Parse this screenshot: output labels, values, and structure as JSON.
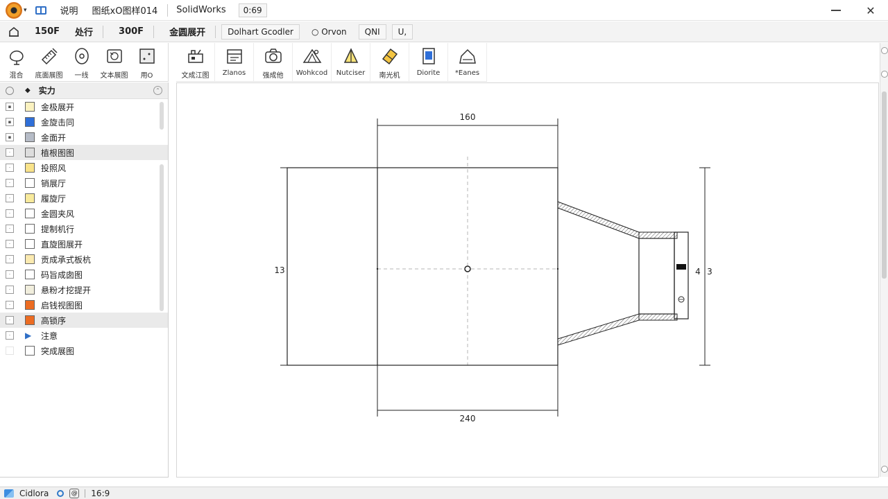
{
  "titlebar": {
    "menu_text": "说明",
    "doc_name": "图纸xO图样014",
    "app_name": "SolidWorks",
    "ratio_badge": "0:69"
  },
  "command_bar": {
    "zoom_value": "150F",
    "menu_label": "处行",
    "scale_value": "300F",
    "feature_title": "金圆展开",
    "buttons": [
      "Dolhart Gcodler",
      "Orvon",
      "QNI",
      "U,"
    ]
  },
  "ribbon_left": [
    {
      "label": "混合",
      "icon": "loft-icon"
    },
    {
      "label": "底面展图",
      "icon": "pencil-ruler-icon"
    },
    {
      "label": "一线",
      "icon": "circle-target-icon"
    },
    {
      "label": "文本展图",
      "icon": "sketch-view-icon"
    },
    {
      "label": "用O",
      "icon": "point-box-icon"
    }
  ],
  "ribbon_right": [
    {
      "label": "文成江图",
      "icon": "hand-tool-icon"
    },
    {
      "label": "Zlanos",
      "icon": "planes-icon"
    },
    {
      "label": "强成他",
      "icon": "camera-icon"
    },
    {
      "label": "Wohkcod",
      "icon": "rib-icon"
    },
    {
      "label": "Nutciser",
      "icon": "tri-shape-icon"
    },
    {
      "label": "南光机",
      "icon": "eraser-icon"
    },
    {
      "label": "Diorite",
      "icon": "doc-panel-icon"
    },
    {
      "label": "*Eanes",
      "icon": "section-icon"
    }
  ],
  "tree": {
    "title": "实力",
    "items": [
      {
        "label": "金极展开",
        "swatch": "#fbf2c0",
        "highlight": false
      },
      {
        "label": "金旋击同",
        "swatch": "#2f6fd8",
        "highlight": false
      },
      {
        "label": "金面开",
        "swatch": "#b6bcc7",
        "highlight": false
      },
      {
        "label": "植根图图",
        "swatch": "#dddddd",
        "highlight": true
      },
      {
        "label": "投照风",
        "swatch": "#f9e38a",
        "highlight": false
      },
      {
        "label": "销展厅",
        "swatch": "#ffffff",
        "highlight": false
      },
      {
        "label": "履旋厅",
        "swatch": "#f8ea9c",
        "highlight": false
      },
      {
        "label": "金圆夹风",
        "swatch": "#ffffff",
        "highlight": false
      },
      {
        "label": "提制机行",
        "swatch": "#ffffff",
        "highlight": false
      },
      {
        "label": "直旋图展开",
        "swatch": "#ffffff",
        "highlight": false
      },
      {
        "label": "贡成承式板杭",
        "swatch": "#fbeab0",
        "highlight": false
      },
      {
        "label": "码旨成囱图",
        "swatch": "#ffffff",
        "highlight": false
      },
      {
        "label": "悬粉才挖提开",
        "swatch": "#f1eedd",
        "highlight": false
      },
      {
        "label": "启钱视图图",
        "swatch": "#ec6c22",
        "highlight": false
      },
      {
        "label": "高锁序",
        "swatch": "#ec6c22",
        "highlight": true
      },
      {
        "label": "注意",
        "swatch": "arrow",
        "highlight": false
      },
      {
        "label": "突成展图",
        "swatch": "#ffffff",
        "highlight": false
      }
    ]
  },
  "drawing": {
    "dim_top": "160",
    "dim_bottom": "240",
    "dim_left": "13",
    "dim_right_a": "4",
    "dim_right_b": "3"
  },
  "statusbar": {
    "left_text": "Cidlora",
    "ratio": "16:9"
  },
  "colors": {
    "accent": "#2f6fc6",
    "line": "#222222",
    "centerline": "#999999"
  }
}
